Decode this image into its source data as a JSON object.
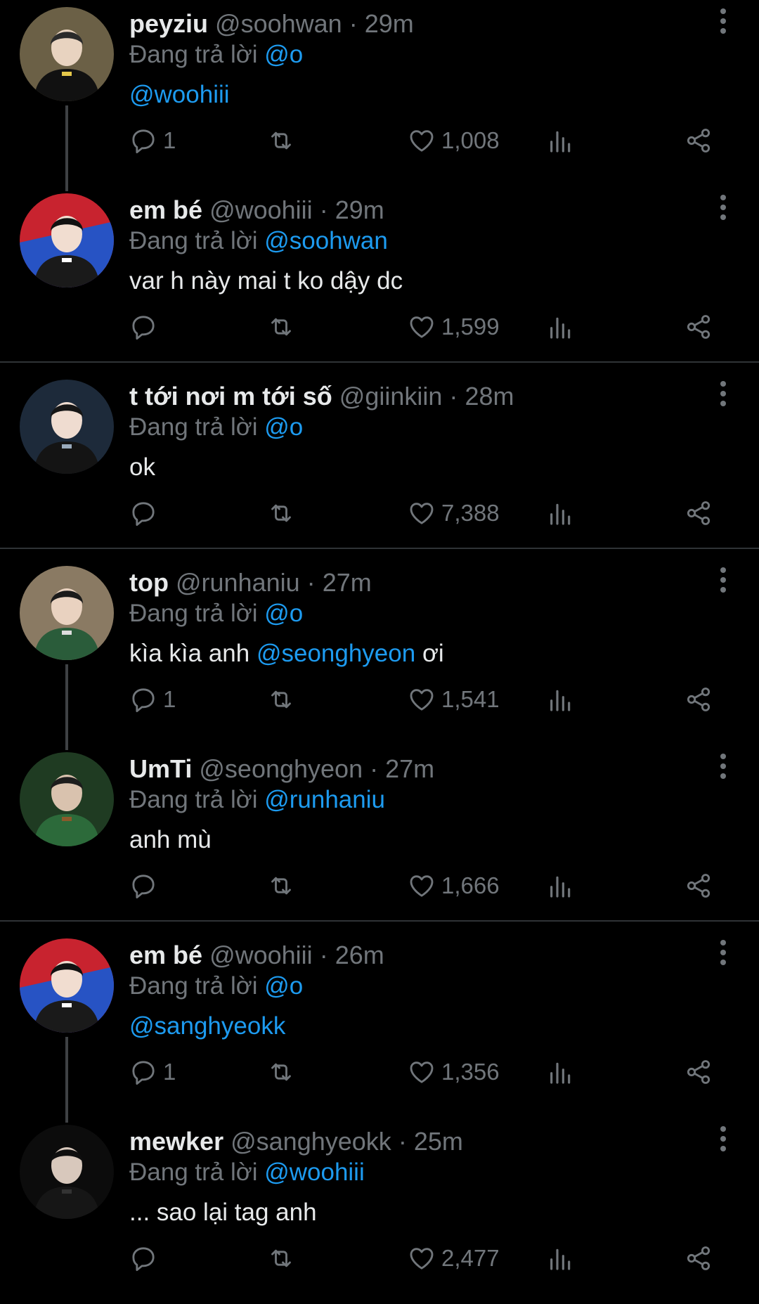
{
  "labels": {
    "replying_to": "Đang trả lời"
  },
  "colors": {
    "background": "#000000",
    "text": "#e7e9ea",
    "muted": "#71767b",
    "link": "#1d9bf0",
    "divider": "#2f3336"
  },
  "tweets": [
    {
      "name": "peyziu",
      "handle": "@soohwan",
      "sep": "·",
      "time": "29m",
      "reply_to": "@o",
      "text": "",
      "mention": "@woohiii",
      "suffix": "",
      "replies": "1",
      "likes": "1,008"
    },
    {
      "name": "em bé",
      "handle": "@woohiii",
      "sep": "·",
      "time": "29m",
      "reply_to": "@soohwan",
      "text": "var h này mai t ko dậy dc",
      "mention": "",
      "suffix": "",
      "replies": "",
      "likes": "1,599"
    },
    {
      "name": "t tới nơi m tới số",
      "handle": "@giinkiin",
      "sep": "·",
      "time": "28m",
      "reply_to": "@o",
      "text": "ok",
      "mention": "",
      "suffix": "",
      "replies": "",
      "likes": "7,388"
    },
    {
      "name": "top",
      "handle": "@runhaniu",
      "sep": "·",
      "time": "27m",
      "reply_to": "@o",
      "text": "kìa kìa anh ",
      "mention": "@seonghyeon",
      "suffix": " ơi",
      "replies": "1",
      "likes": "1,541"
    },
    {
      "name": "UmTi",
      "handle": "@seonghyeon",
      "sep": "·",
      "time": "27m",
      "reply_to": "@runhaniu",
      "text": "anh mù",
      "mention": "",
      "suffix": "",
      "replies": "",
      "likes": "1,666"
    },
    {
      "name": "em bé",
      "handle": "@woohiii",
      "sep": "·",
      "time": "26m",
      "reply_to": "@o",
      "text": "",
      "mention": "@sanghyeokk",
      "suffix": "",
      "replies": "1",
      "likes": "1,356"
    },
    {
      "name": "mewker",
      "handle": "@sanghyeokk",
      "sep": "·",
      "time": "25m",
      "reply_to": "@woohiii",
      "text": "... sao lại tag anh",
      "mention": "",
      "suffix": "",
      "replies": "",
      "likes": "2,477"
    }
  ]
}
